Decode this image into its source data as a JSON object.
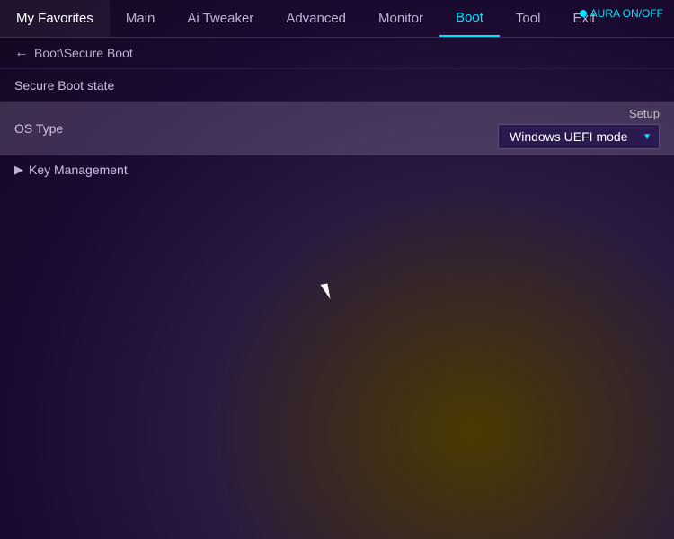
{
  "nav": {
    "items": [
      {
        "id": "my-favorites",
        "label": "My Favorites",
        "active": false
      },
      {
        "id": "main",
        "label": "Main",
        "active": false
      },
      {
        "id": "ai-tweaker",
        "label": "Ai Tweaker",
        "active": false
      },
      {
        "id": "advanced",
        "label": "Advanced",
        "active": false
      },
      {
        "id": "monitor",
        "label": "Monitor",
        "active": false
      },
      {
        "id": "boot",
        "label": "Boot",
        "active": true
      },
      {
        "id": "tool",
        "label": "Tool",
        "active": false
      },
      {
        "id": "exit",
        "label": "Exit",
        "active": false
      }
    ],
    "status_text": "AURA ON/OFF"
  },
  "breadcrumb": {
    "arrow": "←",
    "path": "Boot\\Secure Boot"
  },
  "settings": {
    "secure_boot_state_label": "Secure Boot state",
    "secure_boot_state_value": "",
    "os_type_label": "OS Type",
    "os_type_header": "Setup",
    "os_type_value": "Windows UEFI mode",
    "key_management_label": "Key Management"
  }
}
